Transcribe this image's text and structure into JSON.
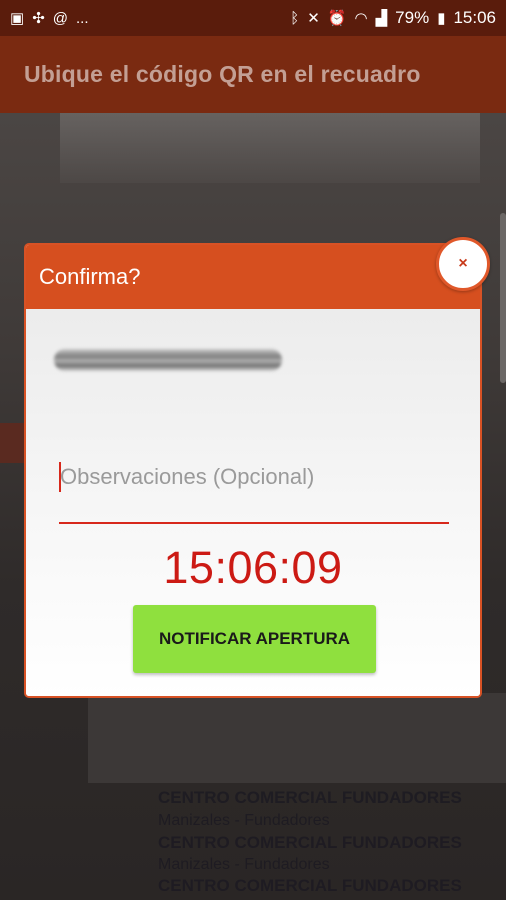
{
  "status_bar": {
    "left_icons": [
      "image-icon",
      "pinwheel-icon",
      "at-sign-icon",
      "more-icon"
    ],
    "more_label": "...",
    "right_icons": [
      "bluetooth-icon",
      "mute-icon",
      "alarm-icon",
      "wifi-icon",
      "signal-icon",
      "battery-icon"
    ],
    "battery": "79%",
    "time": "15:06"
  },
  "app_bar": {
    "title": "Ubique el código QR en el recuadro"
  },
  "background": {
    "lines": [
      "CENTRO COMERCIAL FUNDADORES",
      "Manizales - Fundadores",
      "CENTRO COMERCIAL FUNDADORES",
      "Manizales - Fundadores",
      "CENTRO COMERCIAL FUNDADORES"
    ]
  },
  "dialog": {
    "title": "Confirma?",
    "close_label": "×",
    "observations_placeholder": "Observaciones (Opcional)",
    "observations_value": "",
    "time": "15:06:09",
    "notify_label": "NOTIFICAR APERTURA"
  },
  "colors": {
    "status_bar": "#5a1c0c",
    "app_bar": "#7a2a11",
    "dialog_header": "#d64f1f",
    "time_text": "#cc1a14",
    "notify_button": "#8fe03e",
    "field_underline": "#d7281b"
  }
}
